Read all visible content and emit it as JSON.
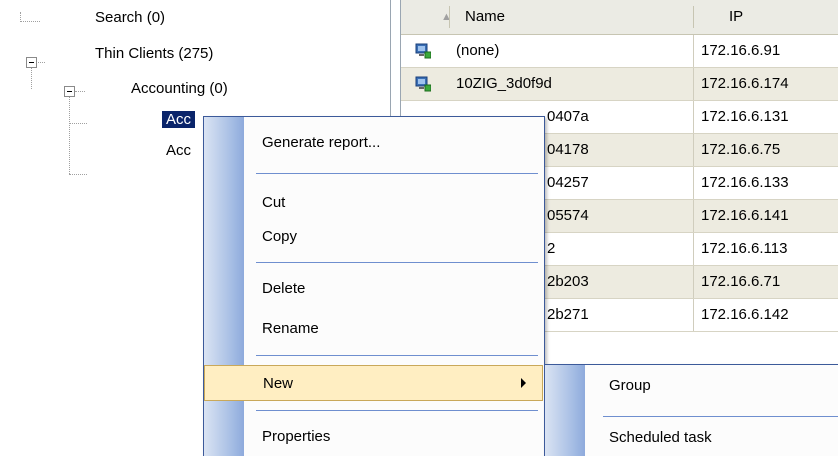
{
  "tree": {
    "search": "Search (0)",
    "thin_clients": "Thin Clients (275)",
    "accounting": "Accounting (0)",
    "selected_child_visible": "Acc",
    "second_child_visible": "Acc"
  },
  "list": {
    "header_name": "Name",
    "header_ip": "IP",
    "rows": [
      {
        "name": "(none)",
        "ip": "172.16.6.91"
      },
      {
        "name": "10ZIG_3d0f9d",
        "ip": "172.16.6.174"
      },
      {
        "name": "0407a",
        "ip": "172.16.6.131"
      },
      {
        "name": "04178",
        "ip": "172.16.6.75"
      },
      {
        "name": "04257",
        "ip": "172.16.6.133"
      },
      {
        "name": "05574",
        "ip": "172.16.6.141"
      },
      {
        "name": "2",
        "ip": "172.16.6.113"
      },
      {
        "name": "2b203",
        "ip": "172.16.6.71"
      },
      {
        "name": "2b271",
        "ip": "172.16.6.142"
      }
    ]
  },
  "context_menu": {
    "generate_report": "Generate report...",
    "cut": "Cut",
    "copy": "Copy",
    "delete": "Delete",
    "rename": "Rename",
    "new": "New",
    "properties": "Properties"
  },
  "submenu": {
    "group": "Group",
    "scheduled_task": "Scheduled task"
  },
  "colors": {
    "selection": "#0a246a",
    "menu_hover": "#ffeec2",
    "menu_border": "#3c5a9a",
    "alt_row": "#edebe0"
  },
  "icons": {
    "row_icon": "thin-client-computer-icon",
    "sort_icon": "sort-ascending-icon",
    "submenu_arrow": "chevron-right-icon",
    "tree_toggle": "minus-box-icon"
  }
}
